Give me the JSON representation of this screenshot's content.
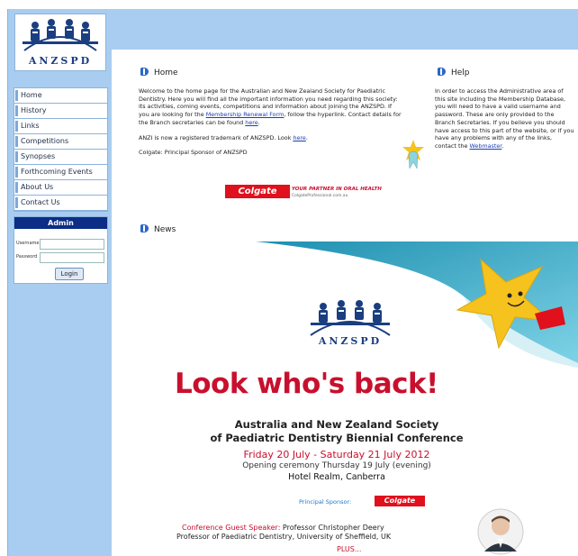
{
  "logo": {
    "text": "ANZSPD"
  },
  "nav": {
    "items": [
      "Home",
      "History",
      "Links",
      "Competitions",
      "Synopses",
      "Forthcoming Events",
      "About Us",
      "Contact Us"
    ]
  },
  "admin": {
    "title": "Admin",
    "username_label": "Username",
    "password_label": "Password",
    "login_label": "Login"
  },
  "home": {
    "heading": "Home",
    "intro_1": "Welcome to the home page for the Australian and New Zealand Society for Paediatric Dentistry. Here you will find all the important information you need regarding this society: its activities, coming events, competitions and information about joining the ANZSPD. If you are looking for the ",
    "membership_link": "Membership Renewal Form",
    "intro_2": ", follow the hyperlink. Contact details for the Branch secretaries can be found ",
    "here_link": "here",
    "intro_3": ".",
    "trademark_1": "ANZI is now a registered trademark of ANZSPD. Look ",
    "trademark_link": "here",
    "trademark_2": ".",
    "sponsor_line": "Colgate: Principal Sponsor of ANZSPD",
    "colgate_logo": "Colgate",
    "colgate_tagline": "YOUR PARTNER IN ORAL HEALTH",
    "colgate_url": "ColgateProfessional.com.au"
  },
  "help": {
    "heading": "Help",
    "text_1": "In order to access the Administrative area of this site including the Membership Database, you will need to have a valid username and password. These are only provided to the Branch Secretaries. If you believe you should have access to this part of the website, or if you have any problems with any of the links, contact the ",
    "webmaster_link": "Webmaster",
    "text_2": "."
  },
  "news": {
    "heading": "News",
    "poster": {
      "logo_text": "ANZSPD",
      "headline": "Look who's back!",
      "line1": "Australia and New Zealand Society",
      "line2": "of Paediatric Dentistry Biennial Conference",
      "dates": "Friday 20 July - Saturday 21 July 2012",
      "opening": "Opening ceremony Thursday 19 July (evening)",
      "venue": "Hotel Realm, Canberra",
      "sponsor_label": "Principal Sponsor:",
      "sponsor_logo": "Colgate",
      "speaker_label": "Conference Guest Speaker:",
      "speaker_name": " Professor Christopher Deery",
      "speaker_role": "Professor of Paediatric Dentistry, University of Sheffield, UK",
      "plus": "PLUS..."
    }
  },
  "colors": {
    "sidebar_bg": "#a9cdf0",
    "admin_title_bg": "#0b2d86",
    "accent_red": "#c8102e",
    "link_blue": "#1b3fb0"
  }
}
